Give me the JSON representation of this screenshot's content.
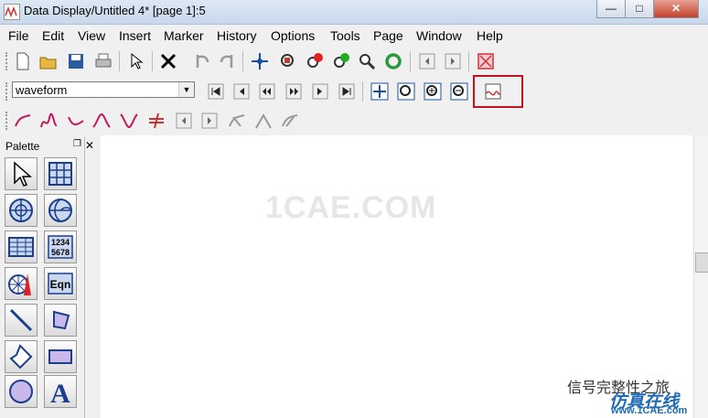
{
  "window": {
    "title": "Data Display/Untitled 4* [page 1]:5",
    "minimize": "—",
    "maximize": "□",
    "close": "✕"
  },
  "menu": [
    "File",
    "Edit",
    "View",
    "Insert",
    "Marker",
    "History",
    "Options",
    "Tools",
    "Page",
    "Window",
    "Help"
  ],
  "toolbar2": {
    "dropdown_value": "waveform"
  },
  "palette": {
    "title": "Palette",
    "dock_icon": "❐",
    "close_icon": "✕",
    "number_label": "1234\n5678",
    "eqn_label": "Eqn"
  },
  "watermark": {
    "main": "1CAE.COM",
    "cn": "信号完整性之旅",
    "brand": "仿真在线",
    "url": "www.1CAE.com"
  },
  "colors": {
    "highlight": "#c6111e",
    "accent_blue": "#1f6bb5",
    "canvas": "#ffffff"
  }
}
